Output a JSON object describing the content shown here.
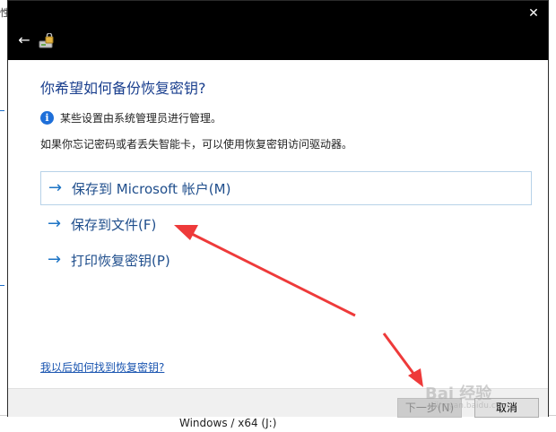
{
  "background": {
    "left_text": "性",
    "bottom_text": "Windows / x64 (J:)"
  },
  "dialog": {
    "close_glyph": "✕",
    "back_glyph": "←",
    "heading": "你希望如何备份恢复密钥?",
    "info_icon_glyph": "i",
    "info_text": "某些设置由系统管理员进行管理。",
    "description": "如果你忘记密码或者丢失智能卡，可以使用恢复密钥访问驱动器。",
    "options": [
      {
        "arrow": "→",
        "label": "保存到 Microsoft 帐户(M)"
      },
      {
        "arrow": "→",
        "label": "保存到文件(F)"
      },
      {
        "arrow": "→",
        "label": "打印恢复密钥(P)"
      }
    ],
    "help_link": "我以后如何找到恢复密钥?",
    "buttons": {
      "next": "下一步(N)",
      "cancel": "取消"
    }
  },
  "watermark": {
    "text": "Bai 经验",
    "sub": "jingyan.baidu.com"
  },
  "colors": {
    "accent": "#1d74c5",
    "annotation_arrow": "#ee3a3a"
  }
}
